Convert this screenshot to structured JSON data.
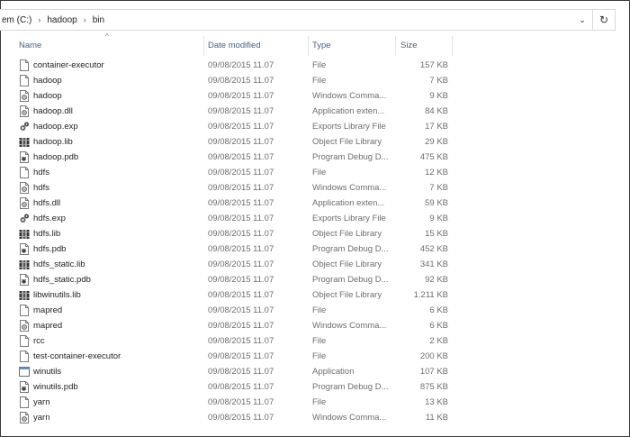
{
  "address": {
    "crumbs": [
      "em (C:)",
      "hadoop",
      "bin"
    ],
    "sep_glyph": "›",
    "dropdown_glyph": "⌄",
    "refresh_glyph": "↻"
  },
  "columns": {
    "name": "Name",
    "date": "Date modified",
    "type": "Type",
    "size": "Size",
    "sort_glyph": "^"
  },
  "files": [
    {
      "name": "container-executor",
      "date": "09/08/2015 11.07",
      "type": "File",
      "size": "157 KB",
      "icon": "blank-file-icon"
    },
    {
      "name": "hadoop",
      "date": "09/08/2015 11.07",
      "type": "File",
      "size": "7 KB",
      "icon": "blank-file-icon"
    },
    {
      "name": "hadoop",
      "date": "09/08/2015 11.07",
      "type": "Windows Comma...",
      "size": "9 KB",
      "icon": "gear-file-icon"
    },
    {
      "name": "hadoop.dll",
      "date": "09/08/2015 11.07",
      "type": "Application exten...",
      "size": "84 KB",
      "icon": "gear-file-icon"
    },
    {
      "name": "hadoop.exp",
      "date": "09/08/2015 11.07",
      "type": "Exports Library File",
      "size": "17 KB",
      "icon": "gears-icon"
    },
    {
      "name": "hadoop.lib",
      "date": "09/08/2015 11.07",
      "type": "Object File Library",
      "size": "29 KB",
      "icon": "library-icon"
    },
    {
      "name": "hadoop.pdb",
      "date": "09/08/2015 11.07",
      "type": "Program Debug D...",
      "size": "475 KB",
      "icon": "debug-file-icon"
    },
    {
      "name": "hdfs",
      "date": "09/08/2015 11.07",
      "type": "File",
      "size": "12 KB",
      "icon": "blank-file-icon"
    },
    {
      "name": "hdfs",
      "date": "09/08/2015 11.07",
      "type": "Windows Comma...",
      "size": "7 KB",
      "icon": "gear-file-icon"
    },
    {
      "name": "hdfs.dll",
      "date": "09/08/2015 11.07",
      "type": "Application exten...",
      "size": "59 KB",
      "icon": "gear-file-icon"
    },
    {
      "name": "hdfs.exp",
      "date": "09/08/2015 11.07",
      "type": "Exports Library File",
      "size": "9 KB",
      "icon": "gears-icon"
    },
    {
      "name": "hdfs.lib",
      "date": "09/08/2015 11.07",
      "type": "Object File Library",
      "size": "15 KB",
      "icon": "library-icon"
    },
    {
      "name": "hdfs.pdb",
      "date": "09/08/2015 11.07",
      "type": "Program Debug D...",
      "size": "452 KB",
      "icon": "debug-file-icon"
    },
    {
      "name": "hdfs_static.lib",
      "date": "09/08/2015 11.07",
      "type": "Object File Library",
      "size": "341 KB",
      "icon": "library-icon"
    },
    {
      "name": "hdfs_static.pdb",
      "date": "09/08/2015 11.07",
      "type": "Program Debug D...",
      "size": "92 KB",
      "icon": "debug-file-icon"
    },
    {
      "name": "libwinutils.lib",
      "date": "09/08/2015 11.07",
      "type": "Object File Library",
      "size": "1.211 KB",
      "icon": "library-icon"
    },
    {
      "name": "mapred",
      "date": "09/08/2015 11.07",
      "type": "File",
      "size": "6 KB",
      "icon": "blank-file-icon"
    },
    {
      "name": "mapred",
      "date": "09/08/2015 11.07",
      "type": "Windows Comma...",
      "size": "6 KB",
      "icon": "gear-file-icon"
    },
    {
      "name": "rcc",
      "date": "09/08/2015 11.07",
      "type": "File",
      "size": "2 KB",
      "icon": "blank-file-icon"
    },
    {
      "name": "test-container-executor",
      "date": "09/08/2015 11.07",
      "type": "File",
      "size": "200 KB",
      "icon": "blank-file-icon"
    },
    {
      "name": "winutils",
      "date": "09/08/2015 11.07",
      "type": "Application",
      "size": "107 KB",
      "icon": "application-icon"
    },
    {
      "name": "winutils.pdb",
      "date": "09/08/2015 11.07",
      "type": "Program Debug D...",
      "size": "875 KB",
      "icon": "debug-file-icon"
    },
    {
      "name": "yarn",
      "date": "09/08/2015 11.07",
      "type": "File",
      "size": "13 KB",
      "icon": "blank-file-icon"
    },
    {
      "name": "yarn",
      "date": "09/08/2015 11.07",
      "type": "Windows Comma...",
      "size": "11 KB",
      "icon": "gear-file-icon"
    }
  ]
}
